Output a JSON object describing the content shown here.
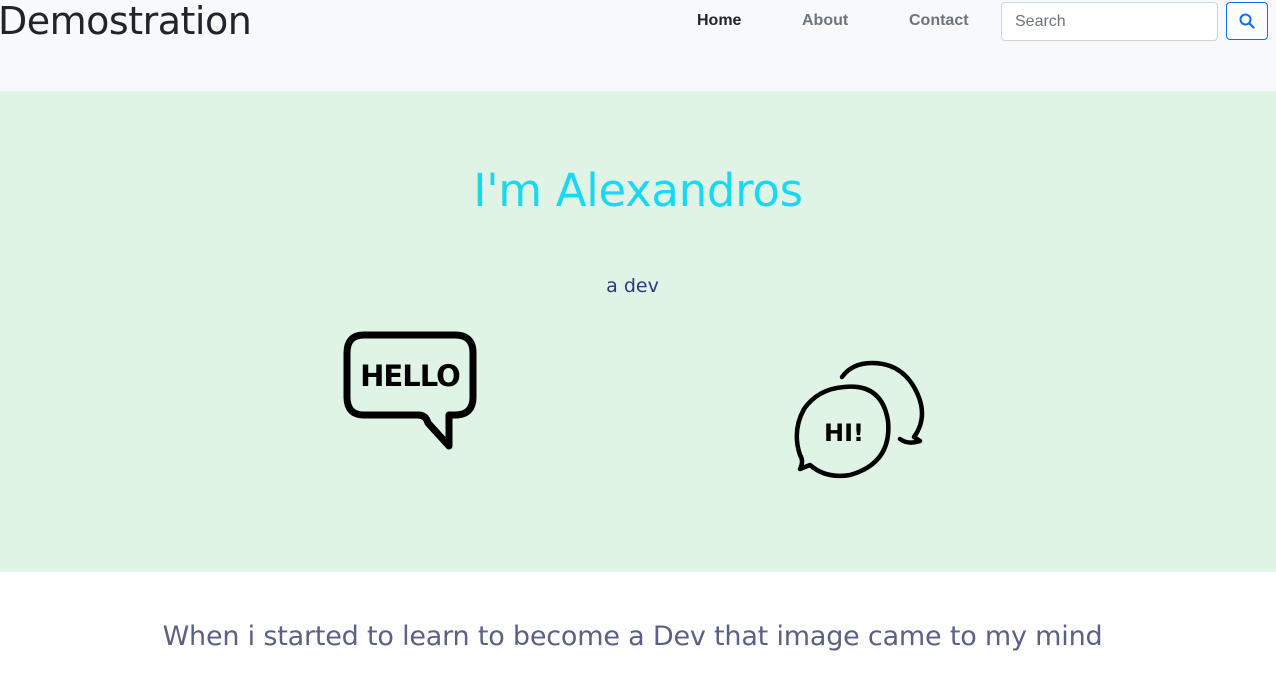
{
  "navbar": {
    "brand": "Demostration",
    "links": [
      {
        "label": "Home",
        "active": true
      },
      {
        "label": "About",
        "active": false
      },
      {
        "label": "Contact",
        "active": false
      }
    ],
    "search": {
      "placeholder": "Search",
      "value": "",
      "button_icon": "search-icon"
    }
  },
  "hero": {
    "title": "I'm Alexandros",
    "subtitle": "a dev",
    "icons": [
      {
        "name": "hello-speech-bubble-icon",
        "text": "HELLO"
      },
      {
        "name": "hi-chat-bubbles-icon",
        "text": "HI!"
      }
    ]
  },
  "intro": {
    "text": "When i started to learn to become a Dev that image came to my mind"
  },
  "colors": {
    "navbar_bg": "#f8f9fa",
    "hero_bg": "#dff4e5",
    "title_accent": "#1ad8f2",
    "subtitle": "#2d3a73",
    "button_border": "#0d6efd"
  }
}
